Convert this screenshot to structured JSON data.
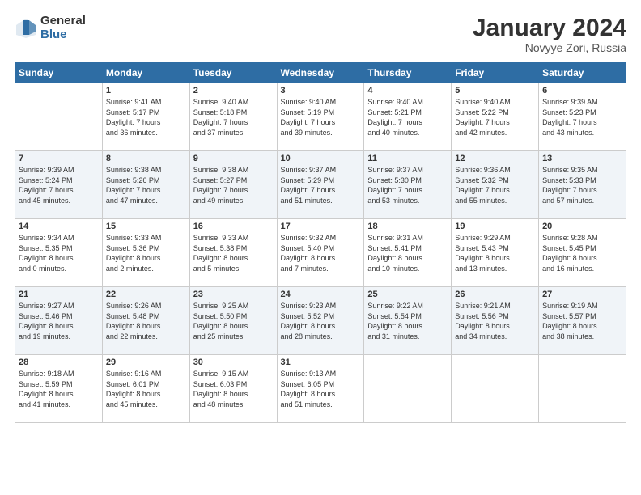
{
  "header": {
    "logo_general": "General",
    "logo_blue": "Blue",
    "month_title": "January 2024",
    "subtitle": "Novyye Zori, Russia"
  },
  "weekdays": [
    "Sunday",
    "Monday",
    "Tuesday",
    "Wednesday",
    "Thursday",
    "Friday",
    "Saturday"
  ],
  "weeks": [
    [
      {
        "day": "",
        "info": ""
      },
      {
        "day": "1",
        "info": "Sunrise: 9:41 AM\nSunset: 5:17 PM\nDaylight: 7 hours\nand 36 minutes."
      },
      {
        "day": "2",
        "info": "Sunrise: 9:40 AM\nSunset: 5:18 PM\nDaylight: 7 hours\nand 37 minutes."
      },
      {
        "day": "3",
        "info": "Sunrise: 9:40 AM\nSunset: 5:19 PM\nDaylight: 7 hours\nand 39 minutes."
      },
      {
        "day": "4",
        "info": "Sunrise: 9:40 AM\nSunset: 5:21 PM\nDaylight: 7 hours\nand 40 minutes."
      },
      {
        "day": "5",
        "info": "Sunrise: 9:40 AM\nSunset: 5:22 PM\nDaylight: 7 hours\nand 42 minutes."
      },
      {
        "day": "6",
        "info": "Sunrise: 9:39 AM\nSunset: 5:23 PM\nDaylight: 7 hours\nand 43 minutes."
      }
    ],
    [
      {
        "day": "7",
        "info": "Sunrise: 9:39 AM\nSunset: 5:24 PM\nDaylight: 7 hours\nand 45 minutes."
      },
      {
        "day": "8",
        "info": "Sunrise: 9:38 AM\nSunset: 5:26 PM\nDaylight: 7 hours\nand 47 minutes."
      },
      {
        "day": "9",
        "info": "Sunrise: 9:38 AM\nSunset: 5:27 PM\nDaylight: 7 hours\nand 49 minutes."
      },
      {
        "day": "10",
        "info": "Sunrise: 9:37 AM\nSunset: 5:29 PM\nDaylight: 7 hours\nand 51 minutes."
      },
      {
        "day": "11",
        "info": "Sunrise: 9:37 AM\nSunset: 5:30 PM\nDaylight: 7 hours\nand 53 minutes."
      },
      {
        "day": "12",
        "info": "Sunrise: 9:36 AM\nSunset: 5:32 PM\nDaylight: 7 hours\nand 55 minutes."
      },
      {
        "day": "13",
        "info": "Sunrise: 9:35 AM\nSunset: 5:33 PM\nDaylight: 7 hours\nand 57 minutes."
      }
    ],
    [
      {
        "day": "14",
        "info": "Sunrise: 9:34 AM\nSunset: 5:35 PM\nDaylight: 8 hours\nand 0 minutes."
      },
      {
        "day": "15",
        "info": "Sunrise: 9:33 AM\nSunset: 5:36 PM\nDaylight: 8 hours\nand 2 minutes."
      },
      {
        "day": "16",
        "info": "Sunrise: 9:33 AM\nSunset: 5:38 PM\nDaylight: 8 hours\nand 5 minutes."
      },
      {
        "day": "17",
        "info": "Sunrise: 9:32 AM\nSunset: 5:40 PM\nDaylight: 8 hours\nand 7 minutes."
      },
      {
        "day": "18",
        "info": "Sunrise: 9:31 AM\nSunset: 5:41 PM\nDaylight: 8 hours\nand 10 minutes."
      },
      {
        "day": "19",
        "info": "Sunrise: 9:29 AM\nSunset: 5:43 PM\nDaylight: 8 hours\nand 13 minutes."
      },
      {
        "day": "20",
        "info": "Sunrise: 9:28 AM\nSunset: 5:45 PM\nDaylight: 8 hours\nand 16 minutes."
      }
    ],
    [
      {
        "day": "21",
        "info": "Sunrise: 9:27 AM\nSunset: 5:46 PM\nDaylight: 8 hours\nand 19 minutes."
      },
      {
        "day": "22",
        "info": "Sunrise: 9:26 AM\nSunset: 5:48 PM\nDaylight: 8 hours\nand 22 minutes."
      },
      {
        "day": "23",
        "info": "Sunrise: 9:25 AM\nSunset: 5:50 PM\nDaylight: 8 hours\nand 25 minutes."
      },
      {
        "day": "24",
        "info": "Sunrise: 9:23 AM\nSunset: 5:52 PM\nDaylight: 8 hours\nand 28 minutes."
      },
      {
        "day": "25",
        "info": "Sunrise: 9:22 AM\nSunset: 5:54 PM\nDaylight: 8 hours\nand 31 minutes."
      },
      {
        "day": "26",
        "info": "Sunrise: 9:21 AM\nSunset: 5:56 PM\nDaylight: 8 hours\nand 34 minutes."
      },
      {
        "day": "27",
        "info": "Sunrise: 9:19 AM\nSunset: 5:57 PM\nDaylight: 8 hours\nand 38 minutes."
      }
    ],
    [
      {
        "day": "28",
        "info": "Sunrise: 9:18 AM\nSunset: 5:59 PM\nDaylight: 8 hours\nand 41 minutes."
      },
      {
        "day": "29",
        "info": "Sunrise: 9:16 AM\nSunset: 6:01 PM\nDaylight: 8 hours\nand 45 minutes."
      },
      {
        "day": "30",
        "info": "Sunrise: 9:15 AM\nSunset: 6:03 PM\nDaylight: 8 hours\nand 48 minutes."
      },
      {
        "day": "31",
        "info": "Sunrise: 9:13 AM\nSunset: 6:05 PM\nDaylight: 8 hours\nand 51 minutes."
      },
      {
        "day": "",
        "info": ""
      },
      {
        "day": "",
        "info": ""
      },
      {
        "day": "",
        "info": ""
      }
    ]
  ]
}
